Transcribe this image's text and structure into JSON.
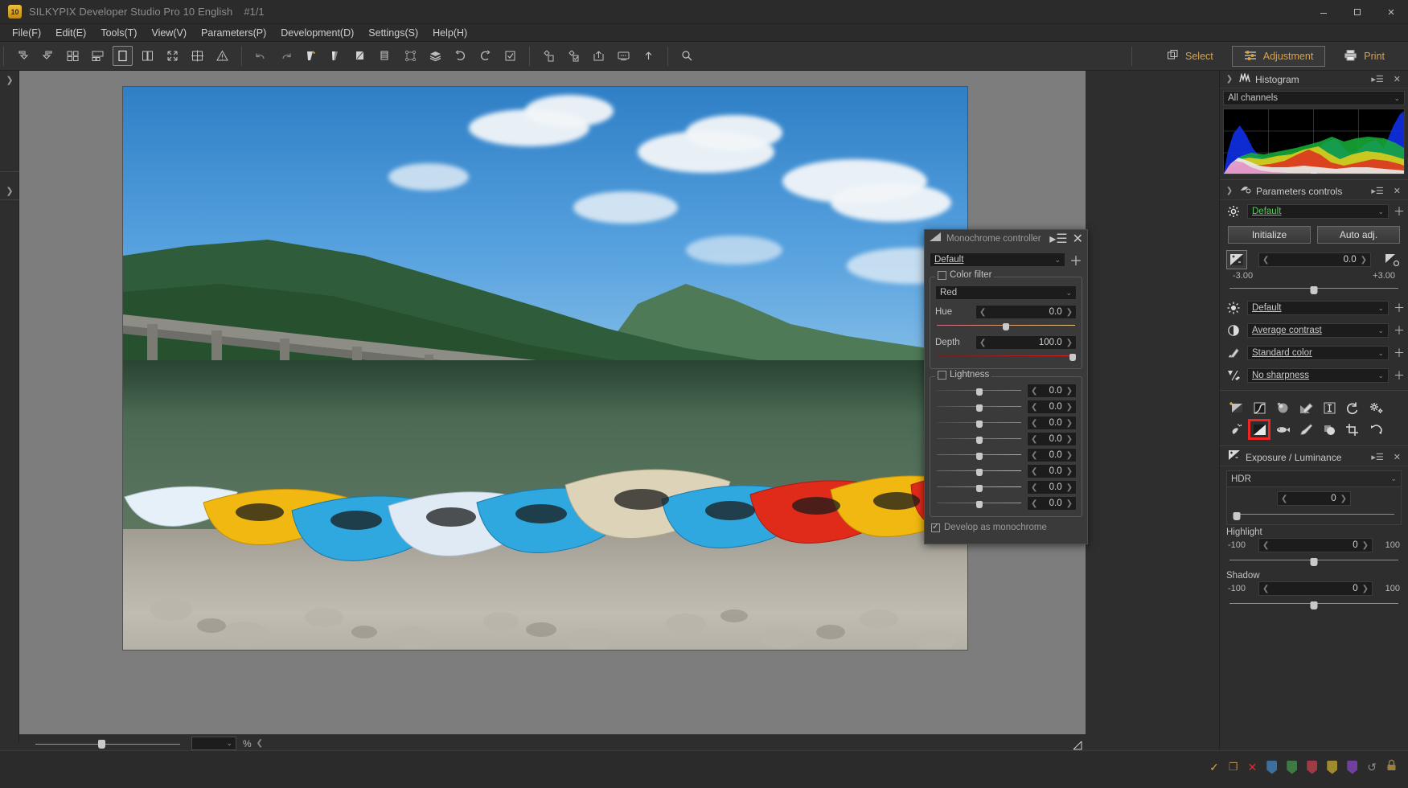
{
  "titlebar": {
    "logo_text": "10",
    "app_title": "SILKYPIX Developer Studio Pro 10 English",
    "image_counter": "#1/1",
    "minimize_label": "—",
    "maximize_label": "❐",
    "close_label": "✕"
  },
  "menubar": {
    "items": [
      {
        "label": "File(F)",
        "accel": "F"
      },
      {
        "label": "Edit(E)",
        "accel": "E"
      },
      {
        "label": "Tools(T)",
        "accel": "T"
      },
      {
        "label": "View(V)",
        "accel": "V"
      },
      {
        "label": "Parameters(P)",
        "accel": "P"
      },
      {
        "label": "Development(D)",
        "accel": "D"
      },
      {
        "label": "Settings(S)",
        "accel": "S"
      },
      {
        "label": "Help(H)",
        "accel": "H"
      }
    ]
  },
  "toolbar": {
    "left_tools": [
      "rotate-left-icon",
      "rotate-right-icon",
      "grid-view-icon",
      "thumbnail-view-icon",
      "single-view-icon",
      "compare-view-icon",
      "fullscreen-icon",
      "multi-view-icon",
      "warning-icon"
    ],
    "edit_tools": [
      "undo-icon",
      "redo-icon",
      "taste-copy-icon",
      "taste-gradient-icon",
      "taste-paste-icon",
      "taste-brush-icon",
      "node-icon",
      "layers-icon",
      "rotate-ccw-icon",
      "rotate-cw-icon",
      "checkbox-icon"
    ],
    "output_tools": [
      "batch-develop-icon",
      "develop-check-icon",
      "export-icon",
      "slideshow-icon",
      "upload-icon"
    ],
    "extra_tools": [
      "search-icon"
    ],
    "modes": [
      {
        "label": "Select",
        "icon": "select-icon",
        "selected": false
      },
      {
        "label": "Adjustment",
        "icon": "adjustment-icon",
        "selected": true
      },
      {
        "label": "Print",
        "icon": "printer-icon",
        "selected": false
      }
    ]
  },
  "histogram_panel": {
    "title": "Histogram",
    "icon": "histogram-icon",
    "menu_icon": "panel-menu-icon",
    "close_icon": "close-icon",
    "channel_select": "All channels"
  },
  "parameters_panel": {
    "title": "Parameters controls",
    "icon": "parameters-icon",
    "preset": "Default",
    "initialize_label": "Initialize",
    "auto_adj_label": "Auto adj.",
    "exposure_value": "0.0",
    "exposure_min": "-3.00",
    "exposure_max": "+3.00",
    "rows": [
      {
        "icon": "brightness-icon",
        "value": "Default"
      },
      {
        "icon": "contrast-icon",
        "value": "Average contrast"
      },
      {
        "icon": "color-icon",
        "value": "Standard color"
      },
      {
        "icon": "sharpness-icon",
        "value": "No sharpness"
      }
    ],
    "tool_icons_row1": [
      "exposure-tool-icon",
      "tone-curve-icon",
      "white-balance-icon",
      "color-tool-icon",
      "noise-reduction-icon",
      "rotate-reset-icon",
      "settings-gear-icon"
    ],
    "tool_icons_row2": [
      "dodge-burn-icon",
      "monochrome-tool-icon",
      "lens-icon",
      "brush-icon",
      "highlight-icon",
      "crop-icon",
      "refresh-icon"
    ],
    "highlighted_tool": "monochrome-tool-icon"
  },
  "exposure_panel": {
    "title": "Exposure / Luminance",
    "icon": "exposure-icon",
    "hdr_label": "HDR",
    "hdr_value": "0",
    "highlight_label": "Highlight",
    "highlight_value": "0",
    "highlight_min": "-100",
    "highlight_max": "100",
    "shadow_label": "Shadow",
    "shadow_value": "0",
    "shadow_min": "-100",
    "shadow_max": "100"
  },
  "monochrome_dialog": {
    "title": "Monochrome controller",
    "icon": "monochrome-icon",
    "menu_icon": "panel-menu-icon",
    "close_icon": "close-icon",
    "preset": "Default",
    "color_filter": {
      "legend": "Color filter",
      "checked": false,
      "color_select": "Red",
      "hue_label": "Hue",
      "hue_value": "0.0",
      "depth_label": "Depth",
      "depth_value": "100.0"
    },
    "lightness": {
      "legend": "Lightness",
      "checked": false,
      "sliders": [
        {
          "color_from": "#7a3030",
          "color_to": "#d06a6a",
          "value": "0.0"
        },
        {
          "color_from": "#7a3050",
          "color_to": "#d06aa8",
          "value": "0.0"
        },
        {
          "color_from": "#5a3070",
          "color_to": "#a86ad0",
          "value": "0.0"
        },
        {
          "color_from": "#30507a",
          "color_to": "#6a9ad0",
          "value": "0.0"
        },
        {
          "color_from": "#307a6a",
          "color_to": "#6ad0b8",
          "value": "0.0"
        },
        {
          "color_from": "#4a7a30",
          "color_to": "#a8d06a",
          "value": "0.0"
        },
        {
          "color_from": "#7a6a30",
          "color_to": "#d0c06a",
          "value": "0.0"
        },
        {
          "color_from": "#7a5030",
          "color_to": "#d0906a",
          "value": "0.0"
        }
      ]
    },
    "develop_as_monochrome_label": "Develop as monochrome",
    "develop_as_monochrome_checked": true
  },
  "zoom_bar": {
    "percent_symbol": "%",
    "zoom_value": "",
    "collapse_icon": "chevron-left-icon"
  },
  "status_bar": {
    "icons": [
      {
        "name": "check-mark-icon",
        "color": "#d8a24a",
        "glyph": "✓"
      },
      {
        "name": "copy-icon",
        "color": "#b08a4a",
        "glyph": "❐"
      },
      {
        "name": "reject-icon",
        "color": "#d03030",
        "glyph": "✕"
      },
      {
        "name": "tag-blue-icon",
        "color": "#3b6f9e"
      },
      {
        "name": "tag-green-icon",
        "color": "#3f7a45"
      },
      {
        "name": "tag-red-icon",
        "color": "#9e3b45"
      },
      {
        "name": "tag-yellow-icon",
        "color": "#9e8a2f"
      },
      {
        "name": "tag-purple-icon",
        "color": "#70409e"
      },
      {
        "name": "undo-tag-icon",
        "color": "#8a8a8a",
        "glyph": "↺"
      },
      {
        "name": "lock-icon",
        "color": "#9a8040",
        "glyph": "🔒"
      }
    ]
  },
  "left_rail": {
    "top_chevron": "❯",
    "bottom_chevron": "❯"
  }
}
